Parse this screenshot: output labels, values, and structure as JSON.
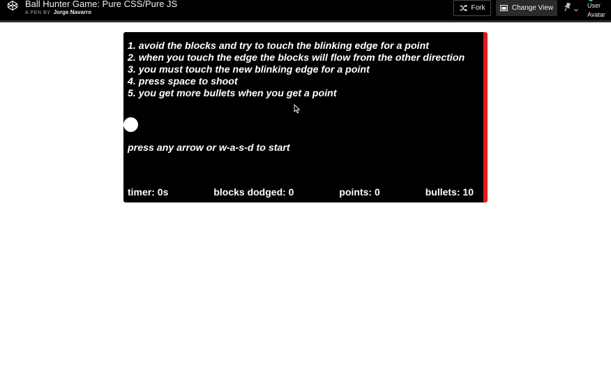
{
  "header": {
    "title": "Ball Hunter Game: Pure CSS/Pure JS",
    "byline_prefix": "A PEN BY",
    "author": "Jorge Navarro",
    "fork_label": "Fork",
    "change_view_label": "Change View",
    "avatar_label": "User Avatar",
    "icons": [
      "codepen-logo-icon",
      "fork-icon",
      "layout-icon",
      "pin-icon",
      "chevron-down-icon"
    ]
  },
  "game": {
    "instructions": [
      "1. avoid the blocks and try to touch the blinking edge for a point",
      "2. when you touch the edge the blocks will flow from the other direction",
      "3. you must touch the new blinking edge for a point",
      "4. press space to shoot",
      "5. you get more bullets when you get a point"
    ],
    "start_message": "press any arrow or w-a-s-d to start",
    "stats": {
      "timer": "timer: 0s",
      "blocks_dodged": "blocks dodged: 0",
      "points": "points: 0",
      "bullets": "bullets: 10"
    },
    "colors": {
      "background": "#000000",
      "blinking_edge": "#e31b1b",
      "ball": "#ffffff"
    }
  }
}
